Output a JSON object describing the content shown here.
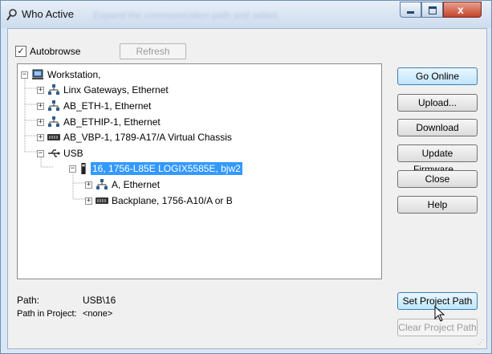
{
  "window": {
    "title": "Who Active",
    "title_background_text": "Expand the communication path and select",
    "close_glyph": "x"
  },
  "autobrowse": {
    "label": "Autobrowse",
    "checked": true,
    "check_glyph": "✓"
  },
  "refresh_label": "Refresh",
  "tree": {
    "nodes": [
      {
        "label": "Workstation,",
        "icon": "workstation-icon",
        "expander": "−"
      },
      {
        "label": "Linx Gateways, Ethernet",
        "icon": "network-icon",
        "expander": "+"
      },
      {
        "label": "AB_ETH-1, Ethernet",
        "icon": "network-icon",
        "expander": "+"
      },
      {
        "label": "AB_ETHIP-1, Ethernet",
        "icon": "network-icon",
        "expander": "+"
      },
      {
        "label": "AB_VBP-1, 1789-A17/A Virtual Chassis",
        "icon": "chassis-icon",
        "expander": "+"
      },
      {
        "label": "USB",
        "icon": "usb-icon",
        "expander": "−"
      },
      {
        "label": "16, 1756-L85E LOGIX5585E, bjw2",
        "icon": "controller-icon",
        "expander": "−",
        "selected": true
      },
      {
        "label": "A, Ethernet",
        "icon": "network-icon",
        "expander": "+"
      },
      {
        "label": "Backplane, 1756-A10/A or B",
        "icon": "chassis-icon",
        "expander": "+"
      }
    ]
  },
  "buttons": {
    "go_online": "Go Online",
    "upload": "Upload...",
    "download": "Download",
    "update_firmware": "Update Firmware...",
    "close": "Close",
    "help": "Help",
    "set_project_path": "Set Project Path",
    "clear_project_path": "Clear Project Path"
  },
  "path": {
    "label": "Path:",
    "value": "USB\\16"
  },
  "path_in_project": {
    "label": "Path in Project:",
    "value": "<none>"
  },
  "colors": {
    "selection": "#3399ff",
    "title_bar": "#cddcee",
    "close_button": "#c5442c"
  }
}
